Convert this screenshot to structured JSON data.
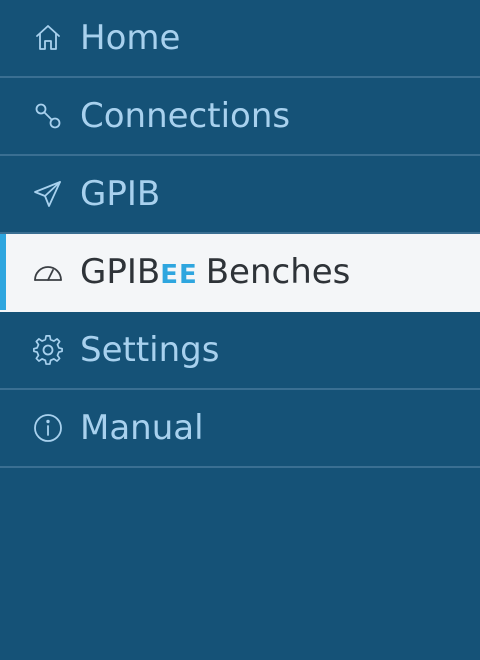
{
  "sidebar": {
    "items": [
      {
        "label": "Home",
        "icon": "home-icon"
      },
      {
        "label": "Connections",
        "icon": "connections-icon"
      },
      {
        "label": "GPIB",
        "icon": "send-icon"
      },
      {
        "label_main": "GPIB",
        "label_suffix": "EE",
        "label_rest": "Benches",
        "icon": "gauge-icon",
        "active": true
      },
      {
        "label": "Settings",
        "icon": "gear-icon"
      },
      {
        "label": "Manual",
        "icon": "info-icon"
      }
    ]
  },
  "colors": {
    "background": "#155277",
    "item_text": "#a8d1ee",
    "active_background": "#f4f6f8",
    "active_text": "#2e3338",
    "accent": "#2ea6df",
    "divider": "#3a6f92"
  }
}
